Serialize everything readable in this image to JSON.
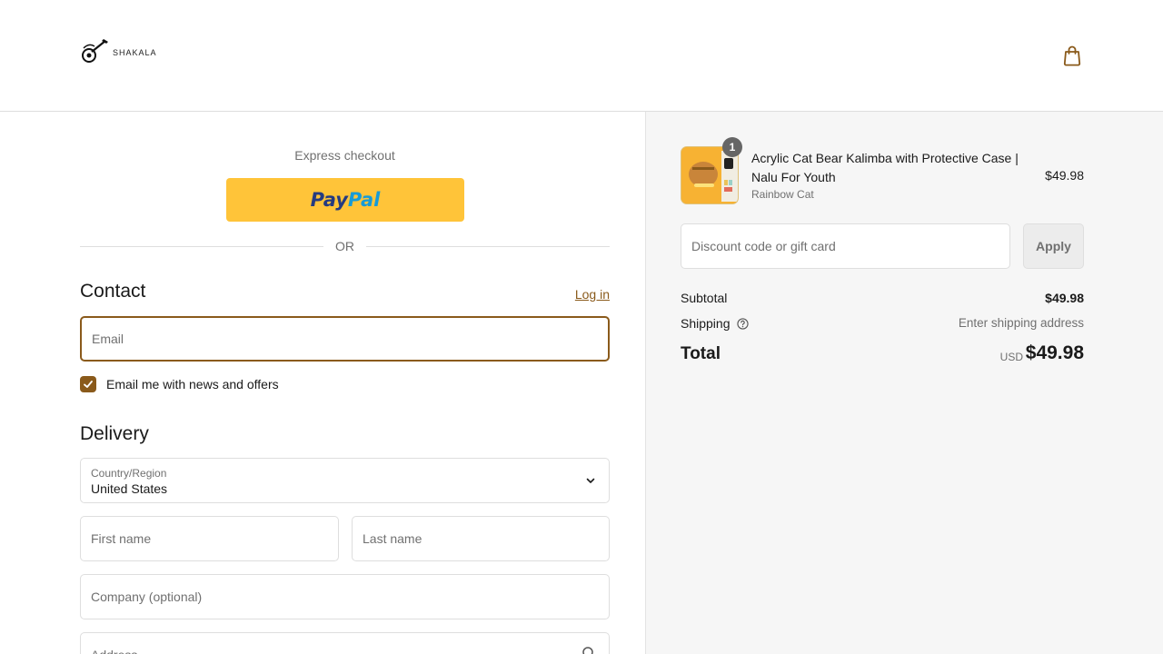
{
  "header": {
    "logo_text": "SHAKALA",
    "cart_icon": "shopping-bag-icon"
  },
  "express": {
    "title": "Express checkout",
    "paypal_pay": "Pay",
    "paypal_pal": "Pal",
    "or": "OR"
  },
  "contact": {
    "title": "Contact",
    "login": "Log in",
    "email_placeholder": "Email",
    "newsletter_label": "Email me with news and offers",
    "newsletter_checked": true
  },
  "delivery": {
    "title": "Delivery",
    "country_label": "Country/Region",
    "country_value": "United States",
    "first_name_placeholder": "First name",
    "last_name_placeholder": "Last name",
    "company_placeholder": "Company (optional)",
    "address_placeholder": "Address"
  },
  "order": {
    "item": {
      "title": "Acrylic Cat Bear Kalimba with Protective Case | Nalu For Youth",
      "variant": "Rainbow Cat",
      "price": "$49.98",
      "quantity": "1"
    },
    "discount_placeholder": "Discount code or gift card",
    "apply_label": "Apply",
    "subtotal_label": "Subtotal",
    "subtotal_value": "$49.98",
    "shipping_label": "Shipping",
    "shipping_value": "Enter shipping address",
    "total_label": "Total",
    "total_currency": "USD",
    "total_value": "$49.98"
  },
  "colors": {
    "accent": "#8a5a1b",
    "paypal_yellow": "#ffc439",
    "summary_bg": "#f6f6f6"
  }
}
